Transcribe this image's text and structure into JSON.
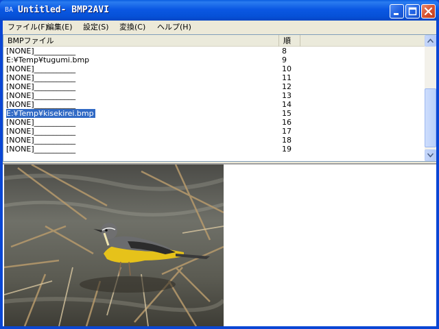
{
  "window": {
    "icon_text": "BA",
    "title": "Untitled- BMP2AVI"
  },
  "menu": [
    {
      "label": "ファイル(F)"
    },
    {
      "label": "編集(E)"
    },
    {
      "label": "設定(S)"
    },
    {
      "label": "変換(C)"
    },
    {
      "label": "ヘルプ(H)"
    }
  ],
  "list": {
    "columns": [
      "BMPファイル",
      "順"
    ],
    "rows": [
      {
        "file": "[NONE]___________",
        "order": "8"
      },
      {
        "file": "E:¥Temp¥tugumi.bmp",
        "order": "9"
      },
      {
        "file": "[NONE]___________",
        "order": "10"
      },
      {
        "file": "[NONE]___________",
        "order": "11"
      },
      {
        "file": "[NONE]___________",
        "order": "12"
      },
      {
        "file": "[NONE]___________",
        "order": "13"
      },
      {
        "file": "[NONE]___________",
        "order": "14"
      },
      {
        "file": "E:¥Temp¥kisekirei.bmp",
        "order": "15",
        "selected": true
      },
      {
        "file": "[NONE]___________",
        "order": "16"
      },
      {
        "file": "[NONE]___________",
        "order": "17"
      },
      {
        "file": "[NONE]___________",
        "order": "18"
      },
      {
        "file": "[NONE]___________",
        "order": "19"
      }
    ]
  },
  "preview": {
    "image": "yellow-wagtail-bird-photo"
  },
  "colors": {
    "selection": "#316ac5",
    "titlebar": "#0b58e3"
  }
}
